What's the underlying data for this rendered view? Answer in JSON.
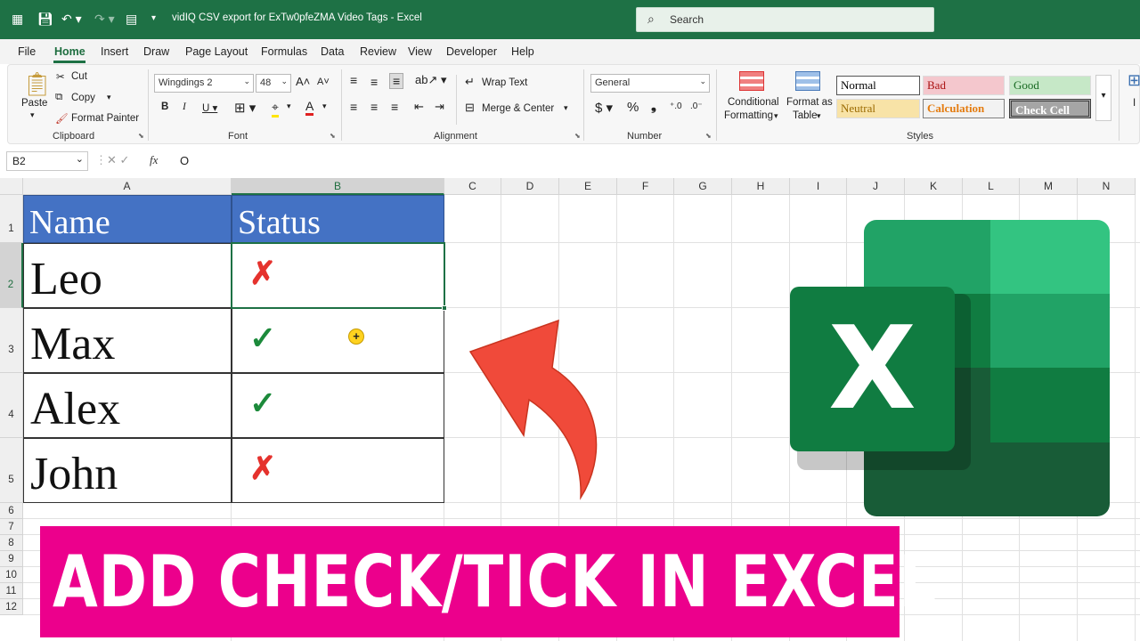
{
  "window": {
    "title": "vidIQ CSV export for ExTw0pfeZMA Video Tags  -  Excel",
    "search_placeholder": "Search"
  },
  "menu": {
    "items": [
      "File",
      "Home",
      "Insert",
      "Draw",
      "Page Layout",
      "Formulas",
      "Data",
      "Review",
      "View",
      "Developer",
      "Help"
    ],
    "active": "Home"
  },
  "ribbon": {
    "clipboard": {
      "paste": "Paste",
      "cut": "Cut",
      "copy": "Copy",
      "format_painter": "Format Painter",
      "label": "Clipboard"
    },
    "font": {
      "name": "Wingdings 2",
      "size": "48",
      "label": "Font"
    },
    "alignment": {
      "wrap_text": "Wrap Text",
      "merge_center": "Merge & Center",
      "label": "Alignment"
    },
    "number": {
      "format": "General",
      "label": "Number"
    },
    "styles": {
      "conditional_formatting_1": "Conditional",
      "conditional_formatting_2": "Formatting",
      "format_as_table_1": "Format as",
      "format_as_table_2": "Table",
      "normal": "Normal",
      "bad": "Bad",
      "good": "Good",
      "neutral": "Neutral",
      "calculation": "Calculation",
      "check_cell": "Check Cell",
      "label": "Styles"
    }
  },
  "formula_bar": {
    "name_box": "B2",
    "value": "O"
  },
  "sheet": {
    "columns": [
      "A",
      "B",
      "C",
      "D",
      "E",
      "F",
      "G",
      "H",
      "I",
      "J",
      "K",
      "L",
      "M",
      "N"
    ],
    "rows": [
      "1",
      "2",
      "3",
      "4",
      "5",
      "6",
      "7",
      "8",
      "9",
      "10",
      "11",
      "12"
    ],
    "selected_cell": "B2",
    "header": {
      "name": "Name",
      "status": "Status"
    },
    "records": [
      {
        "name": "Leo",
        "status": "cross"
      },
      {
        "name": "Max",
        "status": "check"
      },
      {
        "name": "Alex",
        "status": "check"
      },
      {
        "name": "John",
        "status": "cross"
      }
    ]
  },
  "overlay": {
    "banner_text": "ADD CHECK/TICK IN EXCEL",
    "logo_letter": "X",
    "colors": {
      "banner": "#ec008c",
      "arrow": "#f04a3a",
      "excel_green": "#1e7145",
      "header_blue": "#4472c4"
    }
  }
}
